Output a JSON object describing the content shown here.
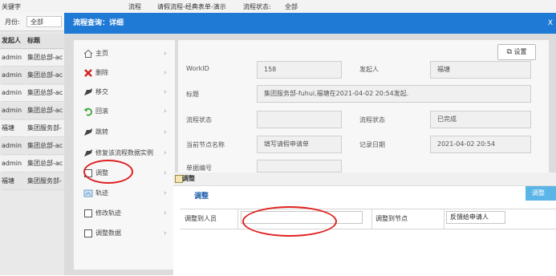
{
  "bg": {
    "keyword_label": "关键字",
    "flow_label": "流程",
    "flow_value": "请假流程-经典表单-演示",
    "status_label": "流程状态:",
    "status_value": "全部",
    "month_label": "月份:",
    "month_value": "全部",
    "col_initiator": "发起人",
    "col_tag": "标题",
    "rows": [
      {
        "initiator": "admin",
        "title": "集团总部-ac"
      },
      {
        "initiator": "admin",
        "title": "集团总部-ac"
      },
      {
        "initiator": "admin",
        "title": "集团总部-ac"
      },
      {
        "initiator": "admin",
        "title": "集团总部-ac"
      },
      {
        "initiator": "福塘",
        "title": "集团服务部-"
      },
      {
        "initiator": "admin",
        "title": "集团总部-ac"
      },
      {
        "initiator": "admin",
        "title": "集团总部-ac"
      },
      {
        "initiator": "福塘",
        "title": "集团服务部-"
      }
    ]
  },
  "dialog": {
    "title": "流程查询：详细",
    "close": "X"
  },
  "menu": {
    "items": [
      {
        "label": "主页",
        "icon": "home-icon"
      },
      {
        "label": "删除",
        "icon": "delete-icon"
      },
      {
        "label": "移交",
        "icon": "transfer-icon"
      },
      {
        "label": "回滚",
        "icon": "rollback-icon"
      },
      {
        "label": "跳转",
        "icon": "jump-icon"
      },
      {
        "label": "修复该流程数据实例",
        "icon": "repair-icon"
      },
      {
        "label": "调整",
        "icon": "adjust-icon"
      },
      {
        "label": "轨迹",
        "icon": "track-icon"
      },
      {
        "label": "修改轨迹",
        "icon": "edit-track-icon"
      },
      {
        "label": "调整数据",
        "icon": "adjust-data-icon"
      }
    ]
  },
  "detail": {
    "settings_button": "设置",
    "workid_label": "WorkID",
    "workid_value": "158",
    "starter_label": "发起人",
    "starter_value": "福塘",
    "title_label": "标题",
    "title_value": "集团服务部-fuhui,福塘在2021-04-02 20:54发起.",
    "flowstate_label": "流程状态",
    "flowstate_value": "",
    "flowstatus_label": "流程状态",
    "flowstatus_value": "已完成",
    "node_label": "当前节点名称",
    "node_value": "填写请假申请单",
    "date_label": "记录日期",
    "date_value": "2021-04-02 20:54",
    "doc_label": "单据编号"
  },
  "adjust": {
    "header": "调整",
    "section_title": "调整",
    "button": "调整",
    "to_person_label": "调整到人员",
    "to_person_value": "",
    "to_node_label": "调整到节点",
    "to_node_value": "反馈给申请人"
  }
}
